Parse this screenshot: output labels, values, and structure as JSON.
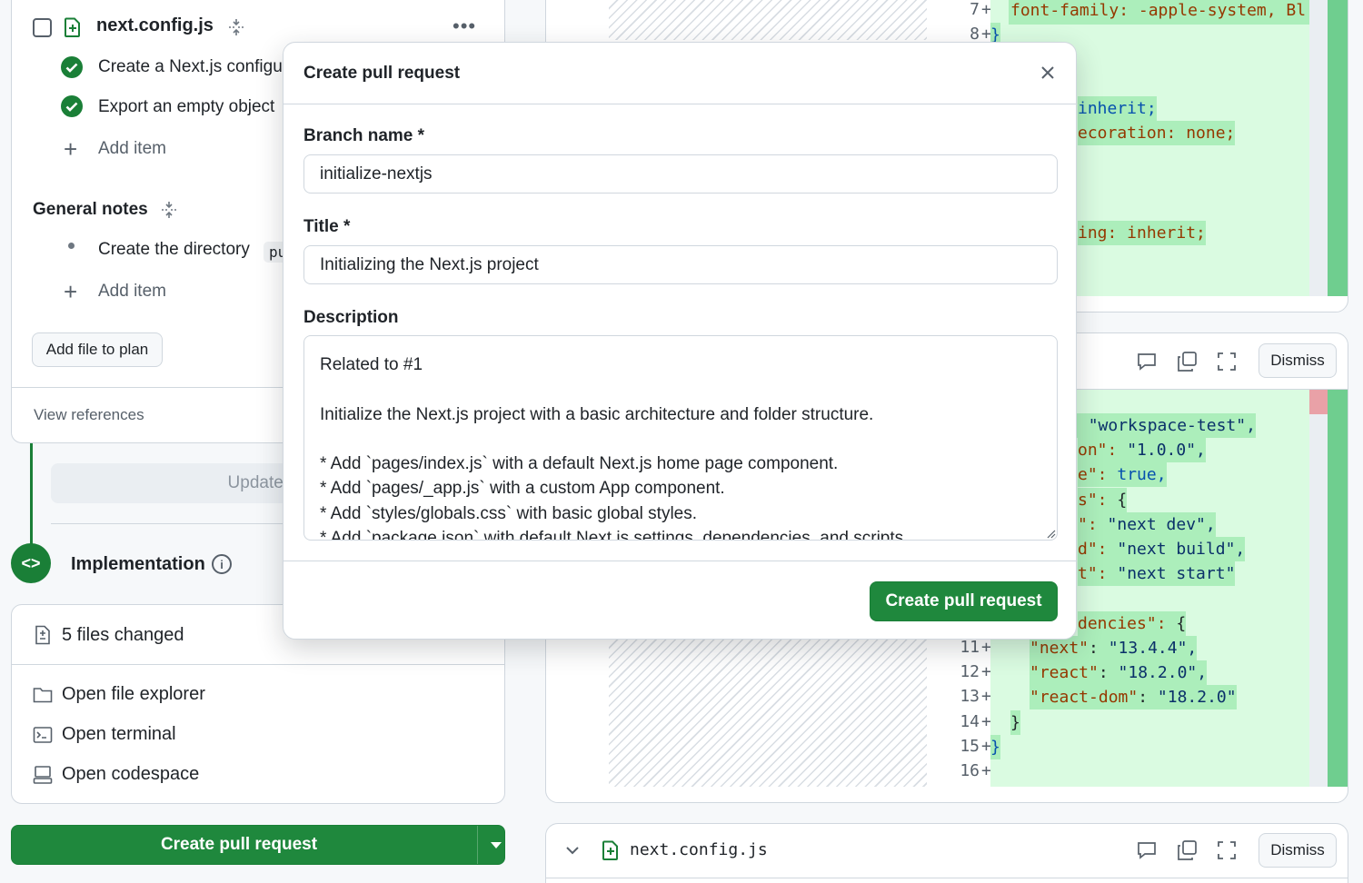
{
  "plan": {
    "file_name": "next.config.js",
    "steps": [
      {
        "label": "Create a Next.js configu",
        "status": "done"
      },
      {
        "label": "Export an empty object",
        "status": "done"
      }
    ],
    "add_item_label": "Add item",
    "general_notes_title": "General notes",
    "general_notes": [
      {
        "label": "Create the directory",
        "suffix": "pu"
      }
    ],
    "add_item_label_2": "Add item",
    "add_file_button": "Add file to plan",
    "view_references": "View references",
    "update_selected_button": "Update selec"
  },
  "implementation": {
    "title": "Implementation",
    "icon_text": "<>",
    "files_changed": "5 files changed",
    "actions": [
      {
        "label": "Open file explorer",
        "icon": "folder-icon"
      },
      {
        "label": "Open terminal",
        "icon": "terminal-icon"
      },
      {
        "label": "Open codespace",
        "icon": "codespace-icon"
      }
    ],
    "create_pr_button": "Create pull request"
  },
  "diff_top": {
    "line_numbers": [
      "7",
      "8"
    ],
    "line_7": "font-family: -apple-system, Bl",
    "line_8": "}",
    "fragments": [
      {
        "text": "inherit;"
      },
      {
        "text": "ecoration: none;"
      },
      {
        "text": "ing: inherit;"
      }
    ]
  },
  "diff_package": {
    "dismiss_label": "Dismiss",
    "fragments": [
      {
        "key": ": ",
        "value": "\"workspace-test\","
      },
      {
        "key": "on\": ",
        "value": "\"1.0.0\","
      },
      {
        "key": "e\": ",
        "value": "true,"
      },
      {
        "key": "s\": ",
        "value": "{"
      },
      {
        "key": "\": ",
        "value": "\"next dev\","
      },
      {
        "key": "d\": ",
        "value": "\"next build\","
      },
      {
        "key": "t\": ",
        "value": "\"next start\""
      },
      {
        "key": "dencies\": ",
        "value": "{"
      }
    ],
    "lines": [
      {
        "num": "11",
        "key": "\"next\"",
        "value": "\"13.4.4\","
      },
      {
        "num": "12",
        "key": "\"react\"",
        "value": "\"18.2.0\","
      },
      {
        "num": "13",
        "key": "\"react-dom\"",
        "value": "\"18.2.0\""
      },
      {
        "num": "14",
        "text": "}"
      },
      {
        "num": "15",
        "text": "}"
      },
      {
        "num": "16",
        "text": ""
      }
    ]
  },
  "diff_bottom": {
    "file_name": "next.config.js",
    "dismiss_label": "Dismiss"
  },
  "modal": {
    "title": "Create pull request",
    "branch_label": "Branch name *",
    "branch_value": "initialize-nextjs",
    "title_label": "Title *",
    "title_value": "Initializing the Next.js project",
    "description_label": "Description",
    "description_lines": [
      "Related to #1",
      "",
      "Initialize the Next.js project with a basic architecture and folder structure.",
      "",
      "* Add `pages/index.js` with a default Next.js home page component.",
      "* Add `pages/_app.js` with a custom App component.",
      "* Add `styles/globals.css` with basic global styles.",
      "* Add `package.json` with default Next.js settings, dependencies, and scripts."
    ],
    "submit_label": "Create pull request"
  },
  "colors": {
    "primary_green": "#1f883d",
    "done_green": "#1a7f37",
    "diff_add_bg": "#dafbe1",
    "diff_add_highlight": "#aceebb"
  }
}
